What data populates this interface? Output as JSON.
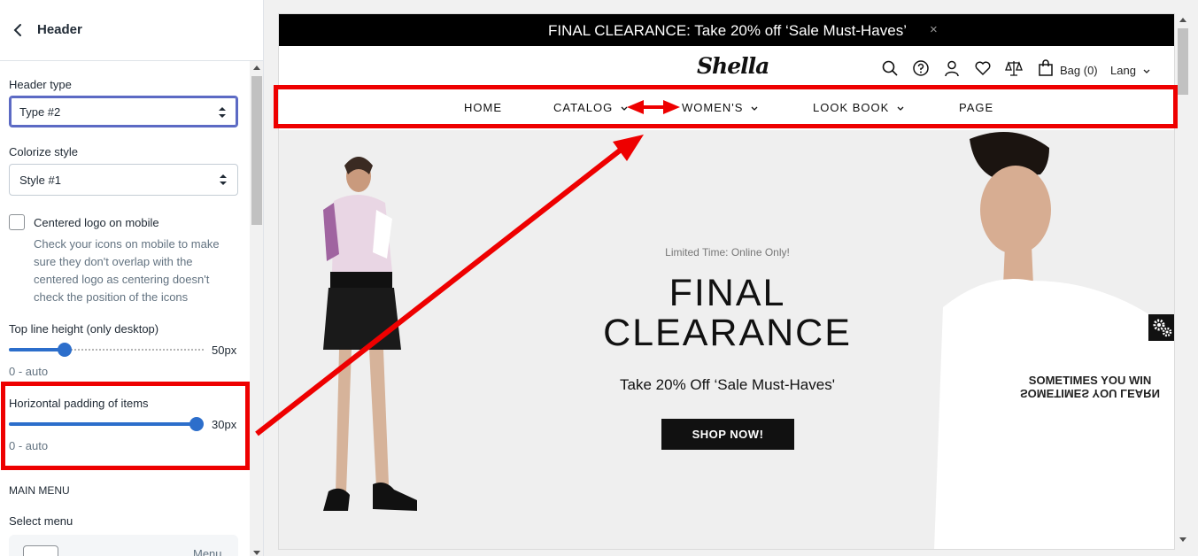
{
  "panel": {
    "title": "Header",
    "header_type": {
      "label": "Header type",
      "value": "Type #2"
    },
    "colorize_style": {
      "label": "Colorize style",
      "value": "Style #1"
    },
    "centered_logo": {
      "label": "Centered logo on mobile",
      "checked": false,
      "help": "Check your icons on mobile to make sure they don't overlap with the centered logo as centering doesn't check the position of the icons"
    },
    "top_line_height": {
      "label": "Top line height (only desktop)",
      "value": "50px",
      "hint": "0 - auto",
      "level": 0.27
    },
    "horizontal_padding": {
      "label": "Horizontal padding of items",
      "value": "30px",
      "hint": "0 - auto",
      "level": 1.0
    },
    "main_menu_heading": "MAIN MENU",
    "select_menu_label": "Select menu",
    "menu_card_text": "Menu"
  },
  "preview": {
    "announcement": "FINAL CLEARANCE: Take 20% off ‘Sale Must-Haves’",
    "announcement_close": "×",
    "logo": "Shella",
    "bag_label": "Bag (0)",
    "lang_label": "Lang",
    "nav": [
      "HOME",
      "CATALOG",
      "WOMEN'S",
      "LOOK BOOK",
      "PAGE"
    ],
    "hero": {
      "kicker": "Limited Time: Online Only!",
      "title_line1": "FINAL",
      "title_line2": "CLEARANCE",
      "subtitle": "Take 20% Off ‘Sale Must-Haves'",
      "button": "SHOP NOW!",
      "shirt_text_line1": "SOMETIMES YOU WIN",
      "shirt_text_line2": "SOMETIMES YOU LEARN"
    }
  },
  "colors": {
    "annotation_red": "#ee0000",
    "slider_blue": "#2c6ecb",
    "focus_border": "#5c6ac4"
  }
}
